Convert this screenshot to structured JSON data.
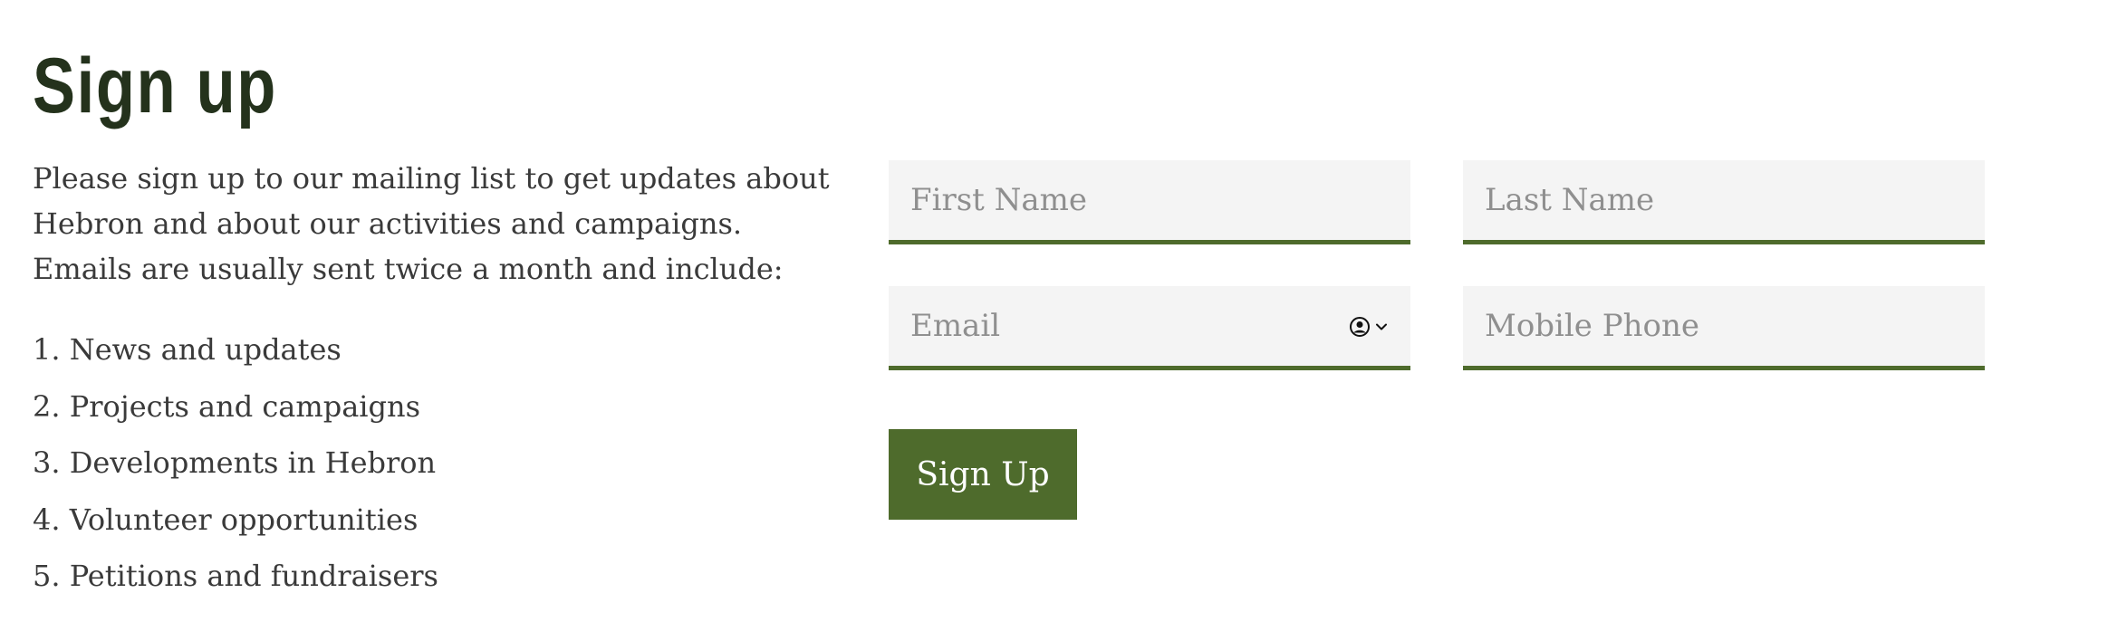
{
  "heading": "Sign up",
  "intro": "Please sign up to our mailing list to get updates about Hebron and about our activities and campaigns. Emails are usually sent twice a month and include:",
  "list_items": [
    "1. News and updates",
    "2. Projects and campaigns",
    "3. Developments in Hebron",
    "4. Volunteer opportunities",
    "5. Petitions and fundraisers"
  ],
  "form": {
    "first_name_placeholder": "First Name",
    "first_name_value": "",
    "last_name_placeholder": "Last Name",
    "last_name_value": "",
    "email_placeholder": "Email",
    "email_value": "",
    "email_autofill_icon": "account-picker-icon",
    "mobile_placeholder": "Mobile Phone",
    "mobile_value": "",
    "submit_label": "Sign Up"
  },
  "colors": {
    "accent": "#4e6b2c",
    "heading": "#24321c",
    "body_text": "#3a3a3a",
    "field_background": "#f4f4f4",
    "placeholder": "#8f8f8f"
  }
}
